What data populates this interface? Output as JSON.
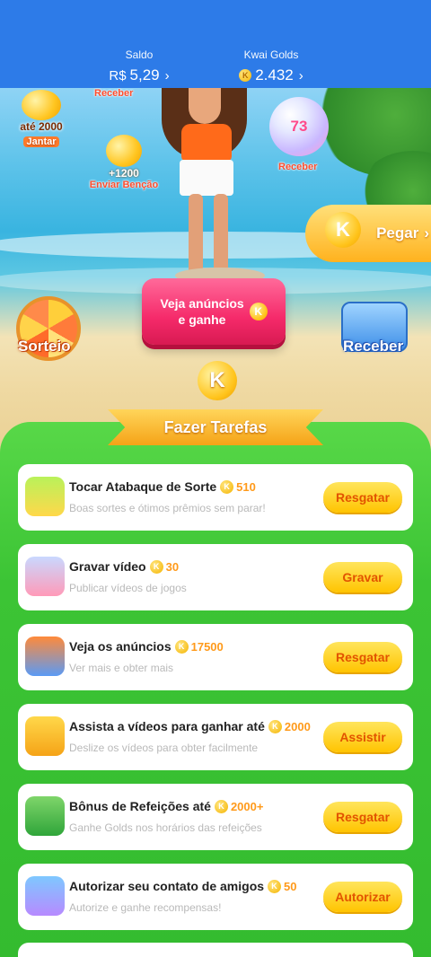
{
  "header": {
    "saldo_label": "Saldo",
    "saldo_currency": "R$",
    "saldo_value": "5,29",
    "golds_label": "Kwai Golds",
    "golds_value": "2.432",
    "chevron": "›"
  },
  "scene": {
    "top_receber": "Receber",
    "jantar_amount": "até 2000",
    "jantar_label": "Jantar",
    "bencao_amount": "+1200",
    "bencao_label": "Enviar Benção",
    "bubble_value": "73",
    "bubble_label": "Receber",
    "pegar_label": "Pegar",
    "pegar_chevron": "›",
    "cta_label_1": "Veja anúncios",
    "cta_label_2": "e ganhe",
    "sorteio_label": "Sorteio",
    "receber_label": "Receber",
    "coin_glyph": "K"
  },
  "tasks_title": "Fazer Tarefas",
  "tasks": [
    {
      "name": "Tocar Atabaque de Sorte",
      "reward": "510",
      "desc": "Boas sortes e ótimos prêmios sem parar!",
      "button": "Resgatar",
      "icon": "drum-icon"
    },
    {
      "name": "Gravar vídeo",
      "reward": "30",
      "desc": "Publicar vídeos de jogos",
      "button": "Gravar",
      "icon": "video-camera-icon"
    },
    {
      "name": "Veja os anúncios",
      "reward": "17500",
      "desc": "Ver mais e obter mais",
      "button": "Resgatar",
      "icon": "tv-icon"
    },
    {
      "name": "Assista a vídeos para ganhar até",
      "reward": "2000",
      "desc": "Deslize os vídeos para obter facilmente",
      "button": "Assistir",
      "icon": "film-camera-icon"
    },
    {
      "name": "Bônus de Refeições até",
      "reward": "2000+",
      "desc": "Ganhe Golds nos horários das refeições",
      "button": "Resgatar",
      "icon": "calendar-icon"
    },
    {
      "name": "Autorizar seu contato de amigos",
      "reward": "50",
      "desc": "Autorize e ganhe recompensas!",
      "button": "Autorizar",
      "icon": "hand-contact-icon"
    }
  ],
  "colors": {
    "header_bg": "#2d7be8",
    "panel_green": "#3cc435",
    "button_yellow": "#ffc400",
    "reward_orange": "#ff9a1a",
    "cta_pink": "#f52a6a"
  }
}
